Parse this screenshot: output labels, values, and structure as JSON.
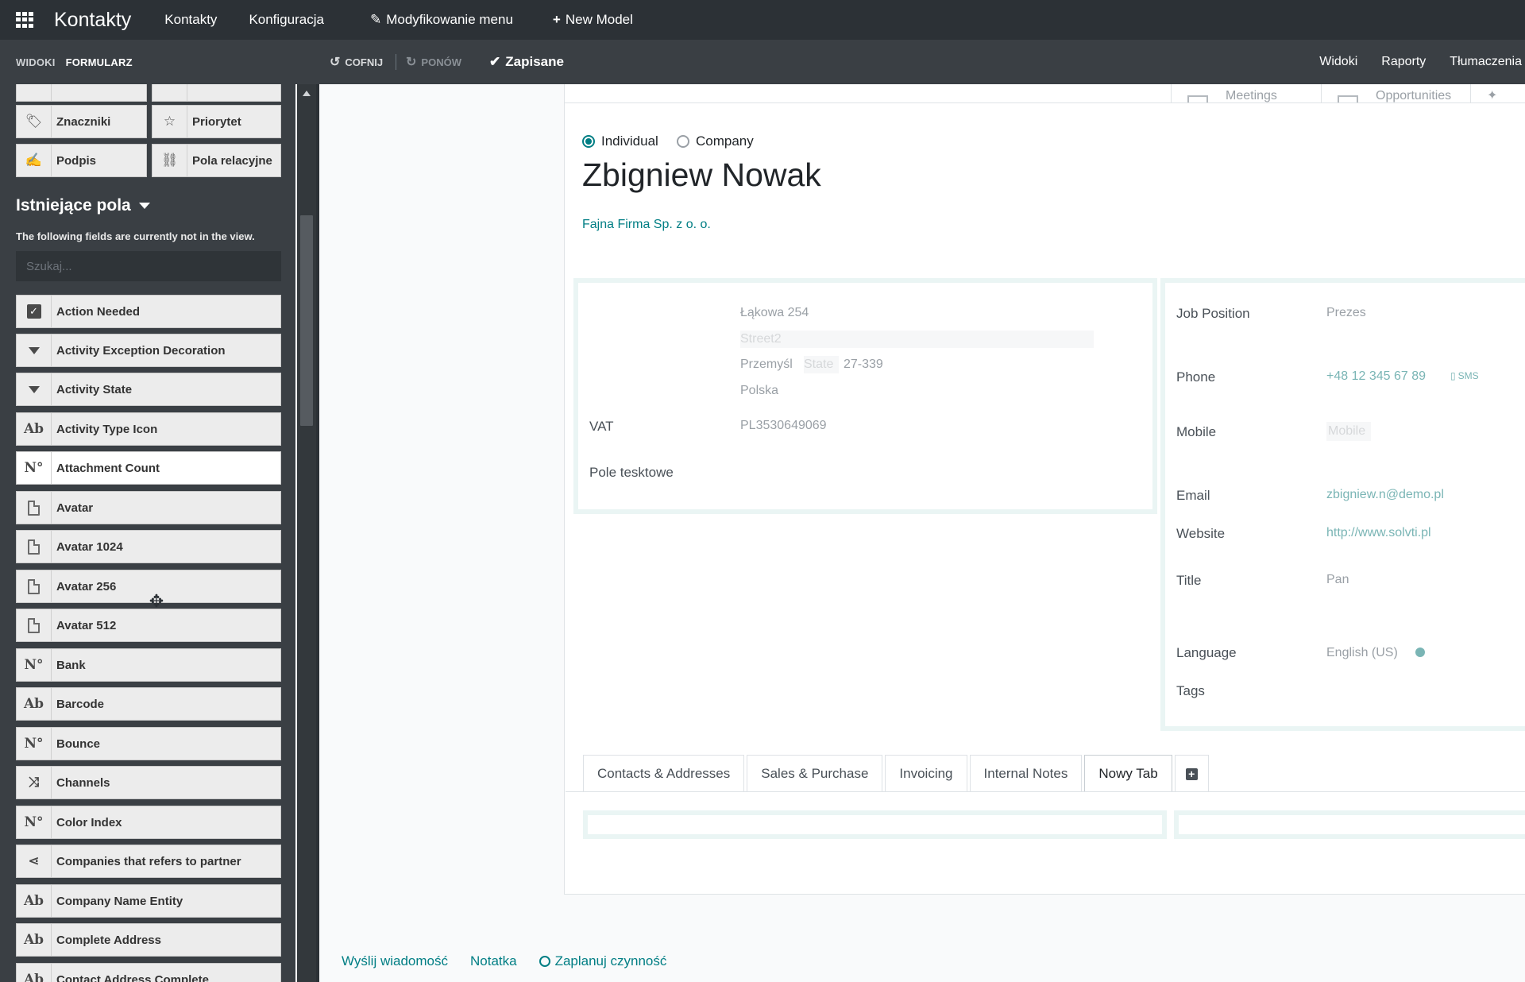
{
  "topbar": {
    "app_title": "Kontakty",
    "menu": [
      "Kontakty",
      "Konfiguracja",
      "Modyfikowanie menu",
      "New Model"
    ]
  },
  "subbar": {
    "tabs": [
      "WIDOKI",
      "FORMULARZ"
    ],
    "undo": "COFNIJ",
    "redo": "PONÓW",
    "saved": "Zapisane",
    "right": [
      "Widoki",
      "Raporty",
      "Tłumaczenia"
    ]
  },
  "sidebar": {
    "components": [
      {
        "label": "Znaczniki",
        "icon": "tag-icon"
      },
      {
        "label": "Priorytet",
        "icon": "star-icon"
      },
      {
        "label": "Podpis",
        "icon": "signature-icon"
      },
      {
        "label": "Pola relacyjne",
        "icon": "link-icon"
      }
    ],
    "existing_title": "Istniejące pola",
    "existing_desc": "The following fields are currently not in the view.",
    "search_placeholder": "Szukaj...",
    "fields": [
      {
        "label": "Action Needed",
        "icon": "checkbox-icon"
      },
      {
        "label": "Activity Exception Decoration",
        "icon": "selection-icon"
      },
      {
        "label": "Activity State",
        "icon": "selection-icon"
      },
      {
        "label": "Activity Type Icon",
        "icon": "text-icon",
        "glyph": "Ab"
      },
      {
        "label": "Attachment Count",
        "icon": "integer-icon",
        "glyph": "N°"
      },
      {
        "label": "Avatar",
        "icon": "binary-icon"
      },
      {
        "label": "Avatar 1024",
        "icon": "binary-icon"
      },
      {
        "label": "Avatar 256",
        "icon": "binary-icon"
      },
      {
        "label": "Avatar 512",
        "icon": "binary-icon"
      },
      {
        "label": "Bank",
        "icon": "integer-icon",
        "glyph": "N°"
      },
      {
        "label": "Barcode",
        "icon": "text-icon",
        "glyph": "Ab"
      },
      {
        "label": "Bounce",
        "icon": "integer-icon",
        "glyph": "N°"
      },
      {
        "label": "Channels",
        "icon": "many2many-icon"
      },
      {
        "label": "Color Index",
        "icon": "integer-icon",
        "glyph": "N°"
      },
      {
        "label": "Companies that refers to partner",
        "icon": "one2many-icon"
      },
      {
        "label": "Company Name Entity",
        "icon": "text-icon",
        "glyph": "Ab"
      },
      {
        "label": "Complete Address",
        "icon": "text-icon",
        "glyph": "Ab"
      },
      {
        "label": "Contact Address Complete",
        "icon": "text-icon",
        "glyph": "Ab"
      }
    ]
  },
  "form": {
    "button_box": [
      "Meetings",
      "Opportunities"
    ],
    "radio_individual": "Individual",
    "radio_company": "Company",
    "name": "Zbigniew Nowak",
    "company": "Fajna Firma Sp. z o. o.",
    "street": "Łąkowa 254",
    "street2_placeholder": "Street2",
    "city": "Przemyśl",
    "state_placeholder": "State",
    "zip": "27-339",
    "country": "Polska",
    "vat_label": "VAT",
    "vat": "PL3530649069",
    "custom_label": "Pole tesktowe",
    "job_label": "Job Position",
    "job": "Prezes",
    "phone_label": "Phone",
    "phone": "+48 12 345 67 89",
    "sms": "SMS",
    "mobile_label": "Mobile",
    "mobile_placeholder": "Mobile",
    "email_label": "Email",
    "email": "zbigniew.n@demo.pl",
    "website_label": "Website",
    "website": "http://www.solvti.pl",
    "title_label": "Title",
    "title": "Pan",
    "language_label": "Language",
    "language": "English (US)",
    "tags_label": "Tags",
    "tabs": [
      "Contacts & Addresses",
      "Sales & Purchase",
      "Invoicing",
      "Internal Notes",
      "Nowy Tab"
    ]
  },
  "chatter": {
    "send_message": "Wyślij wiadomość",
    "log_note": "Notatka",
    "schedule": "Zaplanuj czynność"
  },
  "colors": {
    "topbar": "#2c3136",
    "sidebar": "#3a3f44",
    "accent": "#017e84"
  }
}
